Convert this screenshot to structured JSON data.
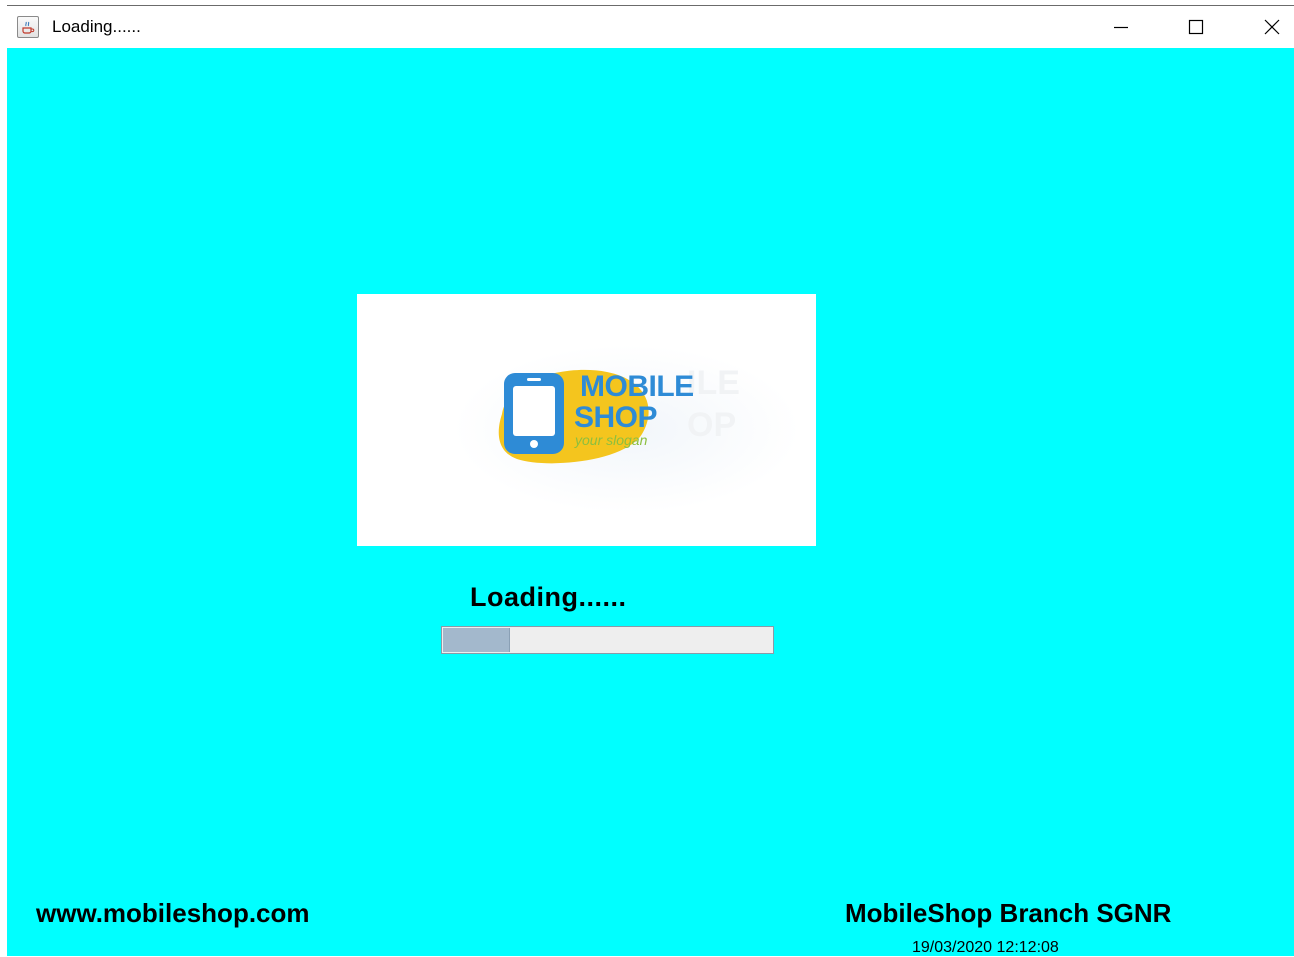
{
  "window": {
    "title": "Loading......",
    "icon": "java-coffee-cup-icon",
    "controls": [
      "minimize-icon",
      "maximize-icon",
      "close-icon"
    ]
  },
  "colors": {
    "background": "#00ffff",
    "progress_fill": "#a3b8cc",
    "progress_track": "#eeeeee",
    "logo_blue": "#2e8bd6",
    "logo_yellow": "#f4c51e"
  },
  "logo": {
    "line1": "MOBILE",
    "line2": "SHOP",
    "slogan": "your slogan",
    "icon": "smartphone-icon"
  },
  "loading": {
    "label": "Loading......",
    "progress_fraction": 0.2
  },
  "footer": {
    "website": "www.mobileshop.com",
    "branch": "MobileShop Branch SGNR",
    "datetime": "19/03/2020 12:12:08"
  }
}
